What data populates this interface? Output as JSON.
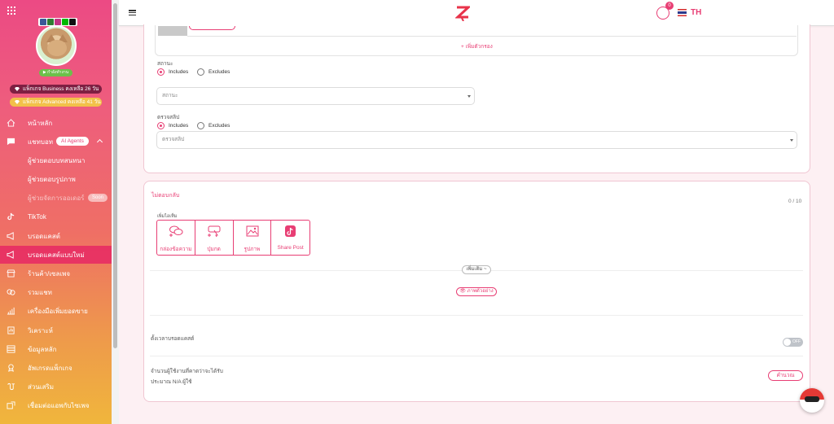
{
  "sidebar": {
    "status_label": "กำลังทำงาน",
    "packages": [
      "แพ็กเกจ Business คงเหลือ 26 วัน",
      "แพ็กเกจ Advanced คงเหลือ 41 วัน"
    ],
    "social_colors": [
      "#3b5998",
      "#2e7d32",
      "#c13584",
      "#00b900",
      "#111111"
    ],
    "menu": [
      {
        "label": "หน้าหลัก",
        "icon": "home-icon"
      },
      {
        "label": "แชทบอท",
        "icon": "chat-icon",
        "badge": "AI Agents"
      },
      {
        "label": "ผู้ช่วยตอบบทสนทนา",
        "icon": ""
      },
      {
        "label": "ผู้ช่วยตอบรูปภาพ",
        "icon": ""
      },
      {
        "label": "ผู้ช่วยจัดการออเดอร์",
        "icon": "",
        "badge": "Soon"
      },
      {
        "label": "TikTok",
        "icon": "tiktok-icon"
      },
      {
        "label": "บรอดแคสต์",
        "icon": "megaphone-icon"
      },
      {
        "label": "บรอดแคสต์แบบใหม่",
        "icon": "megaphone-icon"
      },
      {
        "label": "ร้านค้า/เซลเพจ",
        "icon": "store-icon"
      },
      {
        "label": "รวมแชท",
        "icon": "chats-icon"
      },
      {
        "label": "เครื่องมือเพิ่มยอดขาย",
        "icon": "chart-icon"
      },
      {
        "label": "วิเคราะห์",
        "icon": "report-icon"
      },
      {
        "label": "ข้อมูลหลัก",
        "icon": "list-icon"
      },
      {
        "label": "อัพเกรดแพ็กเกจ",
        "icon": "award-icon"
      },
      {
        "label": "ส่วนเสริม",
        "icon": "addon-icon"
      },
      {
        "label": "เชื่อมต่อแอพกับไซเพจ",
        "icon": "connect-icon"
      }
    ]
  },
  "header": {
    "notification_count": "0",
    "language": "TH"
  },
  "filters": {
    "add_filter": "+ เพิ่มตัวกรอง",
    "status_label": "สถานะ",
    "status_placeholder": "สถานะ",
    "tags_label": "ตรวจสลิป",
    "tags_placeholder": "ตรวจสลิป",
    "includes": "Includes",
    "excludes": "Excludes"
  },
  "message": {
    "title": "ไม่ตอบกลับ",
    "counter": "0 / 10",
    "add_label": "เพิ่มไอเท็ม",
    "tools": [
      "กล่องข้อความ",
      "ปุ่มกด",
      "รูปภาพ",
      "Share Post"
    ],
    "more_pill": "เพิ่มเติม ~",
    "preview_pill": "ภาพตัวอย่าง"
  },
  "schedule": {
    "label": "ตั้งเวลาบรอดแคสต์",
    "toggle": "OFF"
  },
  "estimate": {
    "label": "จำนวนผู้ใช้งานที่คาดว่าจะได้รับ",
    "value": "ประมาณ N/A ผู้ใช้",
    "button": "คำนวณ"
  }
}
